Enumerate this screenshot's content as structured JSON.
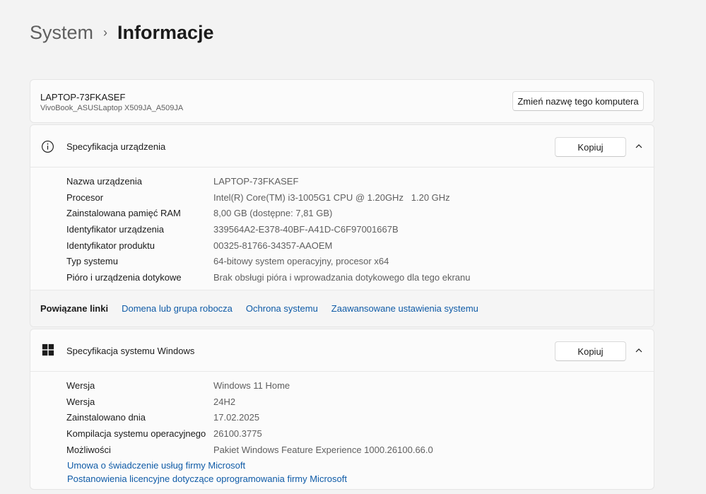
{
  "breadcrumb": {
    "parent": "System",
    "separator": "›",
    "current": "Informacje"
  },
  "pc": {
    "name": "LAPTOP-73FKASEF",
    "model": "VivoBook_ASUSLaptop X509JA_A509JA",
    "rename_label": "Zmień nazwę tego komputera"
  },
  "device_spec": {
    "title": "Specyfikacja urządzenia",
    "copy_label": "Kopiuj",
    "rows": [
      {
        "label": "Nazwa urządzenia",
        "value": "LAPTOP-73FKASEF"
      },
      {
        "label": "Procesor",
        "value": "Intel(R) Core(TM) i3-1005G1 CPU @ 1.20GHz   1.20 GHz"
      },
      {
        "label": "Zainstalowana pamięć RAM",
        "value": "8,00 GB (dostępne: 7,81 GB)"
      },
      {
        "label": "Identyfikator urządzenia",
        "value": "339564A2-E378-40BF-A41D-C6F97001667B"
      },
      {
        "label": "Identyfikator produktu",
        "value": "00325-81766-34357-AAOEM"
      },
      {
        "label": "Typ systemu",
        "value": "64-bitowy system operacyjny, procesor x64"
      },
      {
        "label": "Pióro i urządzenia dotykowe",
        "value": "Brak obsługi pióra i wprowadzania dotykowego dla tego ekranu"
      }
    ],
    "related": {
      "label": "Powiązane linki",
      "links": [
        "Domena lub grupa robocza",
        "Ochrona systemu",
        "Zaawansowane ustawienia systemu"
      ]
    }
  },
  "windows_spec": {
    "title": "Specyfikacja systemu Windows",
    "copy_label": "Kopiuj",
    "rows": [
      {
        "label": "Wersja",
        "value": "Windows 11 Home"
      },
      {
        "label": "Wersja",
        "value": "24H2"
      },
      {
        "label": "Zainstalowano dnia",
        "value": "17.02.2025"
      },
      {
        "label": "Kompilacja systemu operacyjnego",
        "value": "26100.3775"
      },
      {
        "label": "Możliwości",
        "value": "Pakiet Windows Feature Experience 1000.26100.66.0"
      }
    ],
    "links": [
      "Umowa o świadczenie usług firmy Microsoft",
      "Postanowienia licencyjne dotyczące oprogramowania firmy Microsoft"
    ]
  },
  "colors": {
    "link": "#0f5ba7",
    "background": "#f3f3f3",
    "card": "#fbfbfb"
  }
}
